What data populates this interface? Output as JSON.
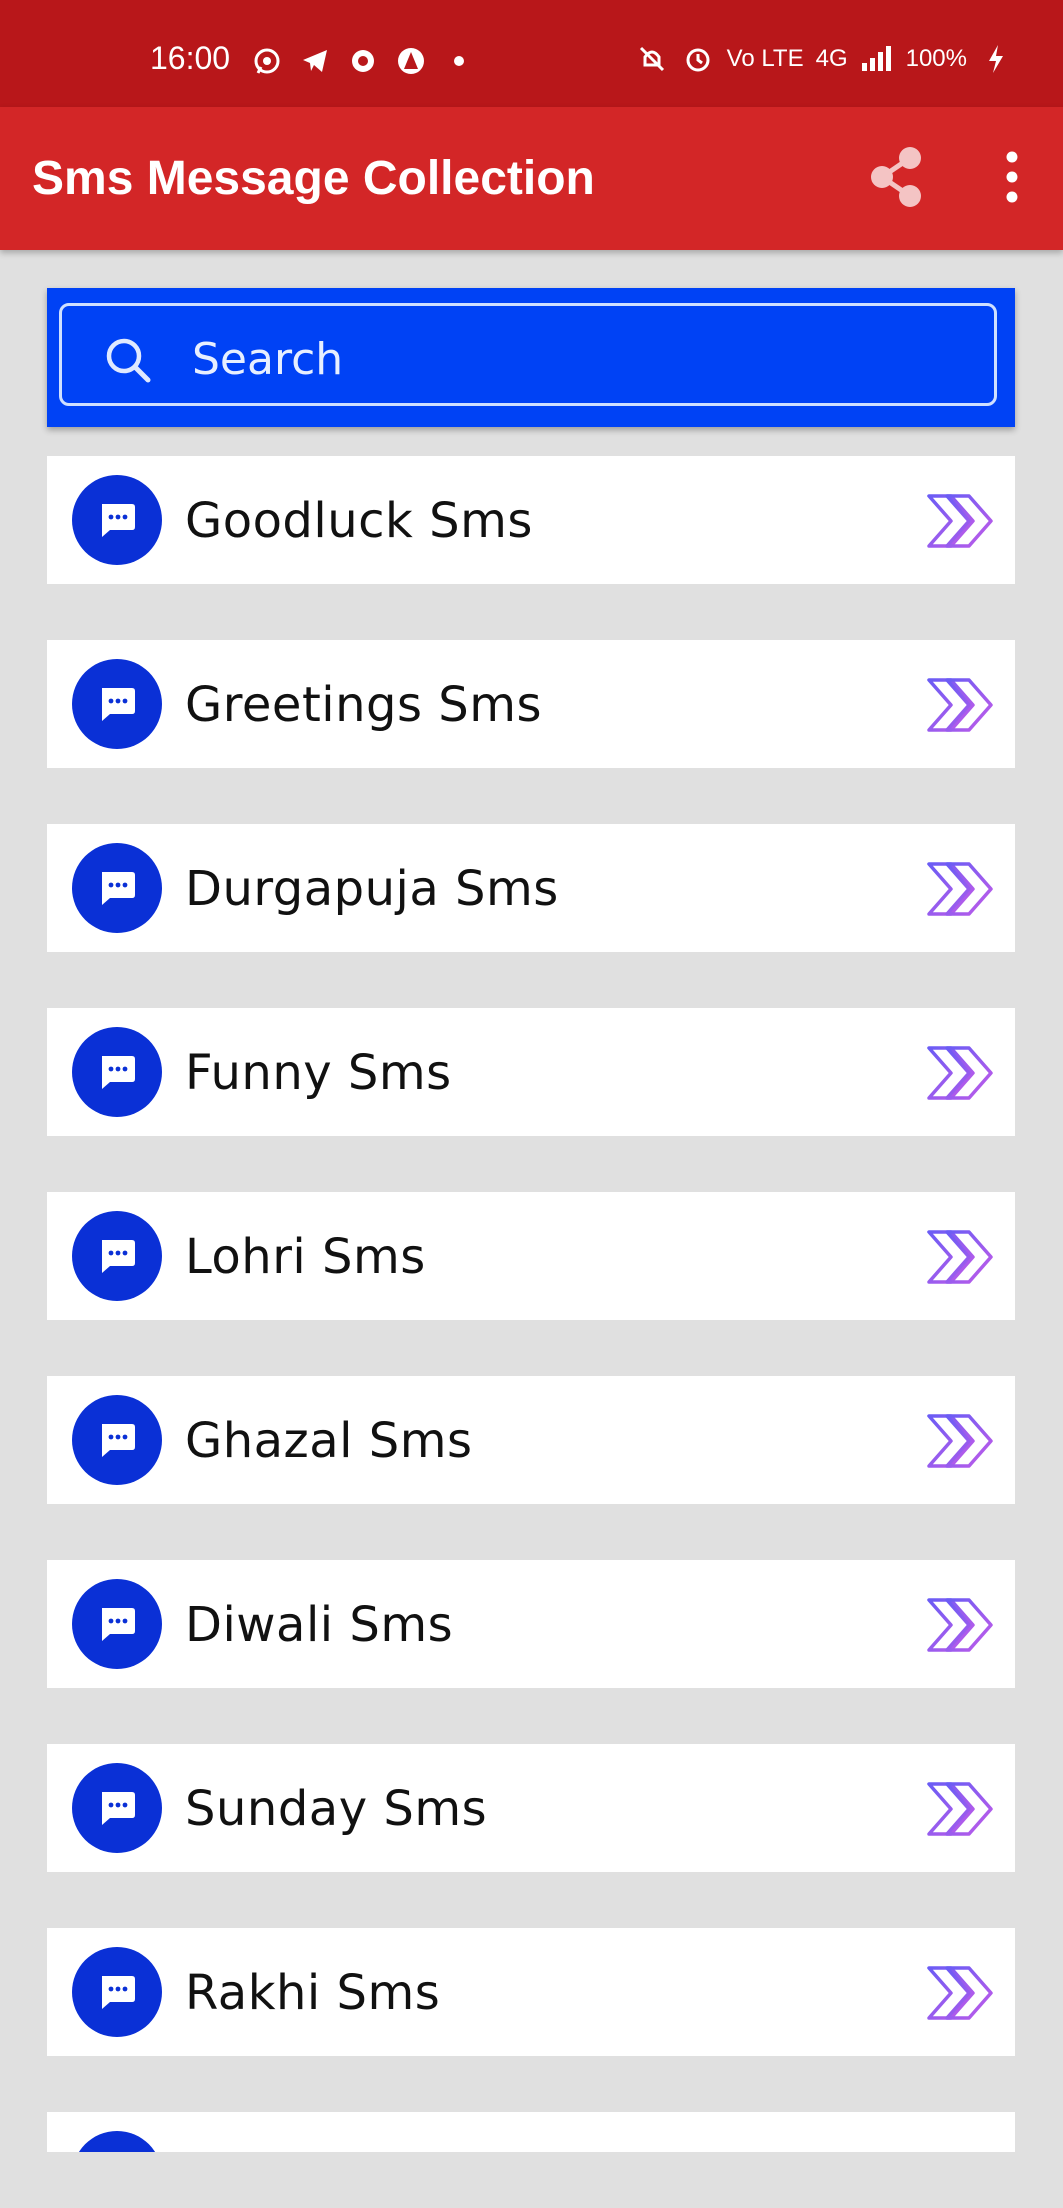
{
  "status_bar": {
    "time": "16:00",
    "left_icons": [
      "whatsapp-icon",
      "telegram-icon",
      "app-icon",
      "vpn-icon",
      "dot-icon"
    ],
    "right_icons": [
      "mute-icon",
      "alarm-icon",
      "volte-icon",
      "signal-4g-icon",
      "signal-icon"
    ],
    "volte_text": "Vo LTE",
    "network_text": "4G",
    "battery": "100%"
  },
  "app_bar": {
    "title": "Sms Message Collection",
    "share_icon": "share-icon",
    "more_icon": "more-vert-icon",
    "color": "#d32627"
  },
  "search": {
    "placeholder": "Search",
    "background": "#0042f5"
  },
  "list": {
    "items": [
      {
        "label": "Goodluck Sms"
      },
      {
        "label": "Greetings Sms"
      },
      {
        "label": "Durgapuja Sms"
      },
      {
        "label": "Funny Sms"
      },
      {
        "label": "Lohri Sms"
      },
      {
        "label": "Ghazal Sms"
      },
      {
        "label": "Diwali Sms"
      },
      {
        "label": "Sunday Sms"
      },
      {
        "label": "Rakhi Sms"
      }
    ],
    "item_icon": "chat-bubble-icon",
    "arrow_icon": "double-chevron-right-icon",
    "accent": "#0a30d6",
    "arrow_gradient": [
      "#6a5cf5",
      "#c35be8"
    ]
  }
}
